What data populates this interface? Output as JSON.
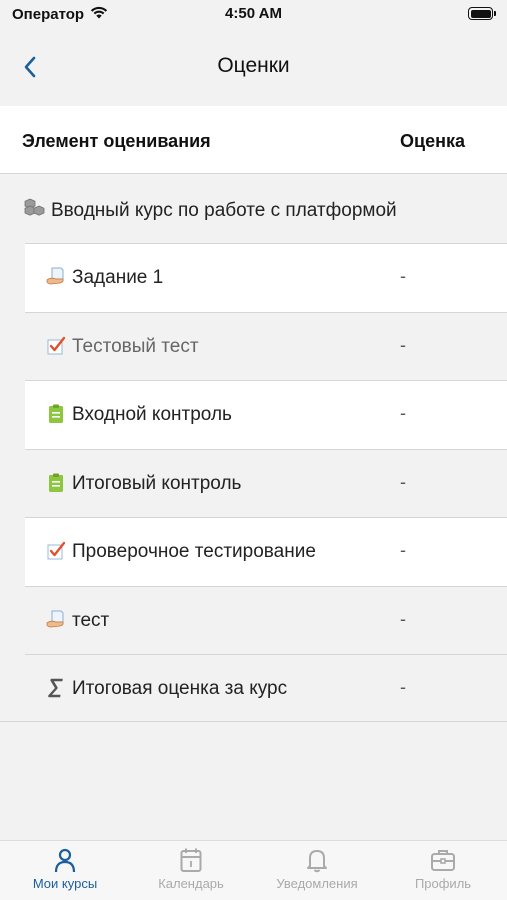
{
  "status_bar": {
    "carrier": "Оператор",
    "time": "4:50 AM"
  },
  "nav": {
    "title": "Оценки"
  },
  "table": {
    "header_item": "Элемент оценивания",
    "header_grade": "Оценка"
  },
  "category": {
    "label": "Вводный курс по работе с платформой",
    "icon": "category-icon"
  },
  "items": [
    {
      "label": "Задание 1",
      "grade": "-",
      "icon": "assignment-icon",
      "muted": false
    },
    {
      "label": "Тестовый тест",
      "grade": "-",
      "icon": "quiz-icon",
      "muted": true
    },
    {
      "label": "Входной контроль",
      "grade": "-",
      "icon": "clipboard-icon",
      "muted": false
    },
    {
      "label": "Итоговый контроль",
      "grade": "-",
      "icon": "clipboard-icon",
      "muted": false
    },
    {
      "label": "Проверочное тестирование",
      "grade": "-",
      "icon": "quiz-icon",
      "muted": false
    },
    {
      "label": "тест",
      "grade": "-",
      "icon": "assignment-icon",
      "muted": false
    },
    {
      "label": "Итоговая оценка за курс",
      "grade": "-",
      "icon": "sigma-icon",
      "muted": false
    }
  ],
  "tab_bar": {
    "tabs": [
      {
        "label": "Мои курсы",
        "icon": "user-icon",
        "active": true
      },
      {
        "label": "Календарь",
        "icon": "calendar-icon",
        "active": false
      },
      {
        "label": "Уведомления",
        "icon": "bell-icon",
        "active": false
      },
      {
        "label": "Профиль",
        "icon": "briefcase-icon",
        "active": false
      }
    ]
  },
  "colors": {
    "accent": "#1a5e9c",
    "tab_inactive": "#aaaaaa",
    "clipboard_green": "#8dc63f",
    "quiz_check": "#e0522d"
  }
}
